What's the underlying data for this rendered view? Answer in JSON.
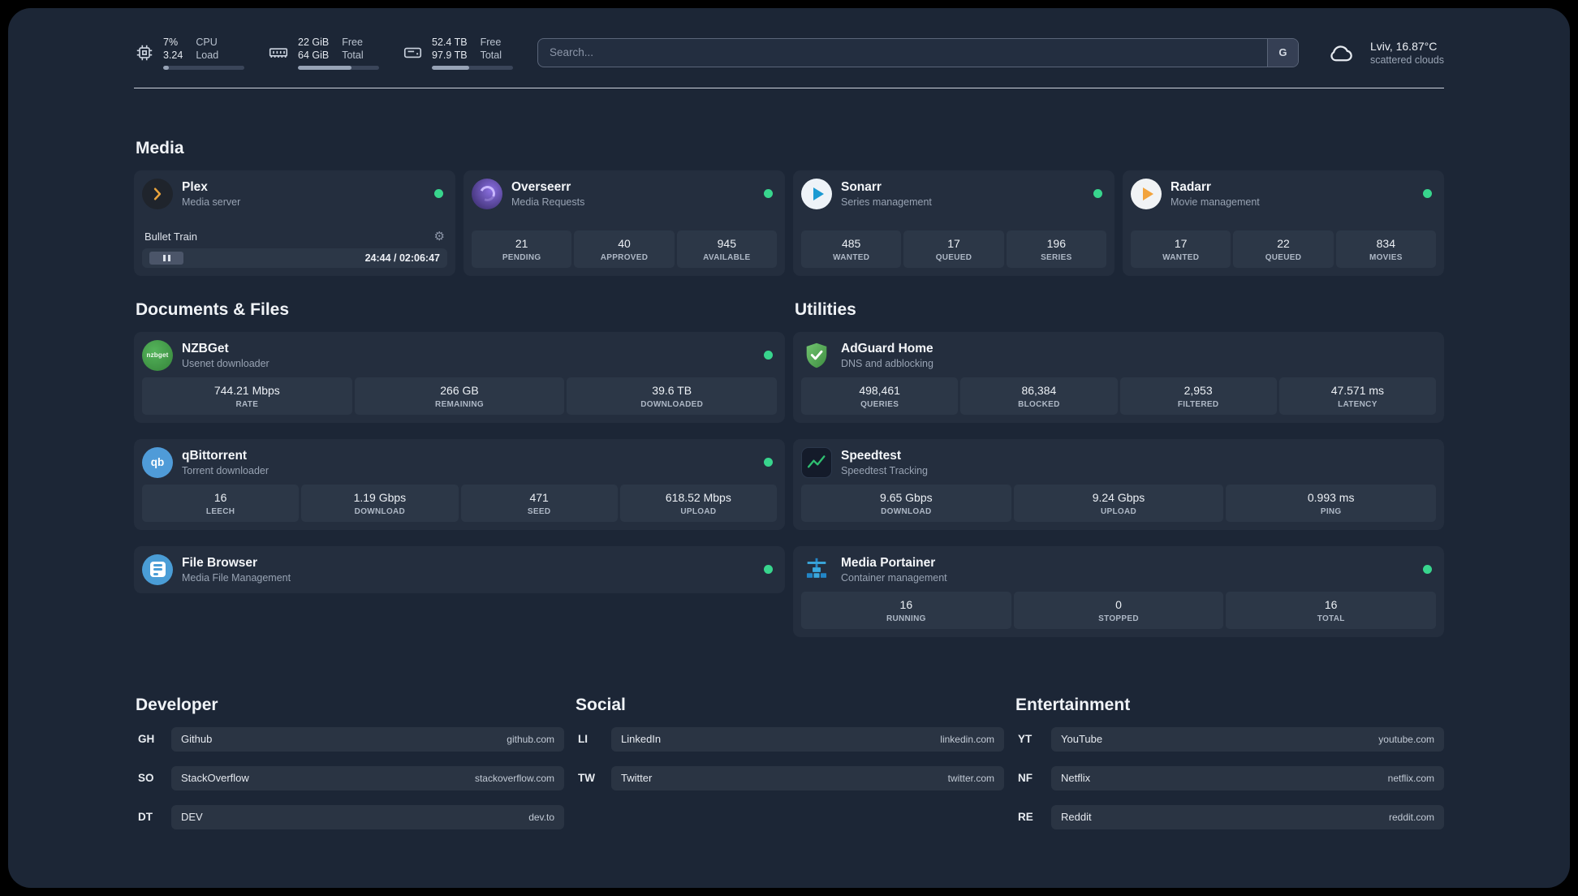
{
  "topbar": {
    "cpu": {
      "icon": "cpu-chip-icon",
      "value_top": "7%",
      "value_bottom": "3.24",
      "label_top": "CPU",
      "label_bottom": "Load",
      "usage_percent": 7
    },
    "memory": {
      "icon": "memory-icon",
      "value_top": "22 GiB",
      "value_bottom": "64 GiB",
      "label_top": "Free",
      "label_bottom": "Total",
      "usage_percent": 66
    },
    "disk": {
      "icon": "hard-disk-icon",
      "value_top": "52.4 TB",
      "value_bottom": "97.9 TB",
      "label_top": "Free",
      "label_bottom": "Total",
      "usage_percent": 46
    },
    "search": {
      "placeholder": "Search...",
      "button_label": "G"
    },
    "weather": {
      "icon": "cloud-icon",
      "location": "Lviv, 16.87°C",
      "condition": "scattered clouds"
    }
  },
  "groups": {
    "media": {
      "title": "Media",
      "services": [
        {
          "name": "Plex",
          "description": "Media server",
          "online": true,
          "player": {
            "title": "Bullet Train",
            "time": "24:44 / 02:06:47",
            "progress_percent": 19
          }
        },
        {
          "name": "Overseerr",
          "description": "Media Requests",
          "online": true,
          "stats": [
            {
              "value": "21",
              "label": "PENDING"
            },
            {
              "value": "40",
              "label": "APPROVED"
            },
            {
              "value": "945",
              "label": "AVAILABLE"
            }
          ]
        },
        {
          "name": "Sonarr",
          "description": "Series management",
          "online": true,
          "stats": [
            {
              "value": "485",
              "label": "WANTED"
            },
            {
              "value": "17",
              "label": "QUEUED"
            },
            {
              "value": "196",
              "label": "SERIES"
            }
          ]
        },
        {
          "name": "Radarr",
          "description": "Movie management",
          "online": true,
          "stats": [
            {
              "value": "17",
              "label": "WANTED"
            },
            {
              "value": "22",
              "label": "QUEUED"
            },
            {
              "value": "834",
              "label": "MOVIES"
            }
          ]
        }
      ]
    },
    "documents": {
      "title": "Documents & Files",
      "services": [
        {
          "name": "NZBGet",
          "description": "Usenet downloader",
          "online": true,
          "icon_text": "nzbget",
          "stats": [
            {
              "value": "744.21 Mbps",
              "label": "RATE"
            },
            {
              "value": "266 GB",
              "label": "REMAINING"
            },
            {
              "value": "39.6 TB",
              "label": "DOWNLOADED"
            }
          ]
        },
        {
          "name": "qBittorrent",
          "description": "Torrent downloader",
          "online": true,
          "icon_text": "qb",
          "stats": [
            {
              "value": "16",
              "label": "LEECH"
            },
            {
              "value": "1.19 Gbps",
              "label": "DOWNLOAD"
            },
            {
              "value": "471",
              "label": "SEED"
            },
            {
              "value": "618.52 Mbps",
              "label": "UPLOAD"
            }
          ]
        },
        {
          "name": "File Browser",
          "description": "Media File Management",
          "online": true,
          "stats": []
        }
      ]
    },
    "utilities": {
      "title": "Utilities",
      "services": [
        {
          "name": "AdGuard Home",
          "description": "DNS and adblocking",
          "stats": [
            {
              "value": "498,461",
              "label": "QUERIES"
            },
            {
              "value": "86,384",
              "label": "BLOCKED"
            },
            {
              "value": "2,953",
              "label": "FILTERED"
            },
            {
              "value": "47.571 ms",
              "label": "LATENCY"
            }
          ]
        },
        {
          "name": "Speedtest",
          "description": "Speedtest Tracking",
          "stats": [
            {
              "value": "9.65 Gbps",
              "label": "DOWNLOAD"
            },
            {
              "value": "9.24 Gbps",
              "label": "UPLOAD"
            },
            {
              "value": "0.993 ms",
              "label": "PING"
            }
          ]
        },
        {
          "name": "Media Portainer",
          "description": "Container management",
          "online": true,
          "stats": [
            {
              "value": "16",
              "label": "RUNNING"
            },
            {
              "value": "0",
              "label": "STOPPED"
            },
            {
              "value": "16",
              "label": "TOTAL"
            }
          ]
        }
      ]
    }
  },
  "bookmarks": [
    {
      "title": "Developer",
      "items": [
        {
          "abbr": "GH",
          "name": "Github",
          "domain": "github.com"
        },
        {
          "abbr": "SO",
          "name": "StackOverflow",
          "domain": "stackoverflow.com"
        },
        {
          "abbr": "DT",
          "name": "DEV",
          "domain": "dev.to"
        }
      ]
    },
    {
      "title": "Social",
      "items": [
        {
          "abbr": "LI",
          "name": "LinkedIn",
          "domain": "linkedin.com"
        },
        {
          "abbr": "TW",
          "name": "Twitter",
          "domain": "twitter.com"
        }
      ]
    },
    {
      "title": "Entertainment",
      "items": [
        {
          "abbr": "YT",
          "name": "YouTube",
          "domain": "youtube.com"
        },
        {
          "abbr": "NF",
          "name": "Netflix",
          "domain": "netflix.com"
        },
        {
          "abbr": "RE",
          "name": "Reddit",
          "domain": "reddit.com"
        }
      ]
    }
  ],
  "colors": {
    "background": "#1c2636",
    "card": "#242e3e",
    "status_online": "#38d58d",
    "plex_gold": "#e8a33d",
    "overseerr_purple": "#8a6fe0",
    "sonarr_blue": "#1b9ad2",
    "radarr_orange": "#f2a33c",
    "nzbget_green": "#3f9a44",
    "qbittorrent_blue": "#4f9bd8",
    "filebrowser_blue": "#4a9dd6",
    "adguard_green": "#55a85a",
    "speedtest_green": "#2fbf71",
    "portainer_blue": "#3aa8dd"
  }
}
